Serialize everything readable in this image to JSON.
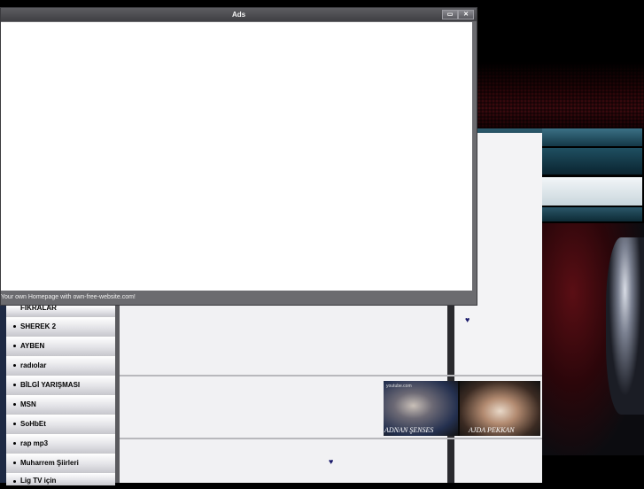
{
  "ads_window": {
    "title": "Ads",
    "footer": "Your own Homepage with own-free-website.com!",
    "controls": [
      "maximize",
      "close"
    ]
  },
  "sidebar": {
    "items": [
      {
        "label": "FIKRALAR"
      },
      {
        "label": "SHEREK 2"
      },
      {
        "label": "AYBEN"
      },
      {
        "label": "radıolar"
      },
      {
        "label": "BİLGİ YARIŞMASI"
      },
      {
        "label": "MSN"
      },
      {
        "label": "SoHbEt"
      },
      {
        "label": "rap mp3"
      },
      {
        "label": "Muharrem Şiirleri"
      },
      {
        "label": "Lig TV için"
      }
    ]
  },
  "thumbnails": [
    {
      "caption": "ADNAN ŞENSES",
      "watermark": "youtube.com"
    },
    {
      "caption": "AJDA PEKKAN"
    }
  ],
  "hearts": [
    "♥",
    "♥"
  ],
  "colors": {
    "titlebar": "#4a4a4e",
    "nav_bg": "#e4e4e8",
    "panel_bg": "#f1f1f3",
    "heart": "#1b1b6b"
  }
}
